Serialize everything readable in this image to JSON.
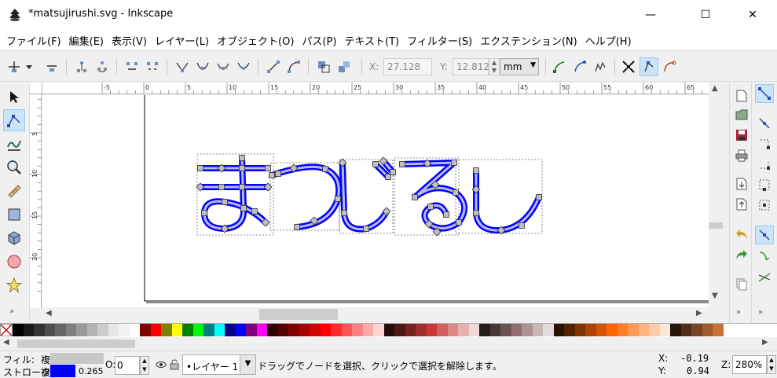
{
  "window": {
    "title": "*matsujirushi.svg - Inkscape",
    "app_icon": "inkscape-icon",
    "controls": {
      "minimize": "—",
      "maximize": "☐",
      "close": "✕"
    }
  },
  "menu": [
    "ファイル(F)",
    "編集(E)",
    "表示(V)",
    "レイヤー(L)",
    "オブジェクト(O)",
    "パス(P)",
    "テキスト(T)",
    "フィルター(S)",
    "エクステンション(N)",
    "ヘルプ(H)"
  ],
  "toolcontrols": {
    "x_label": "X:",
    "x_value": "27.128",
    "y_label": "Y:",
    "y_value": "12.812",
    "unit": "mm"
  },
  "rulers": {
    "h_ticks": [
      "-5",
      "0",
      "5",
      "10",
      "15",
      "20",
      "25",
      "30",
      "35",
      "40",
      "45",
      "50",
      "55",
      "60",
      "65"
    ],
    "v_ticks": [
      "0",
      "5",
      "10",
      "15",
      "20"
    ]
  },
  "colors": {
    "stroke": "#0000ff",
    "accent": "#99c9ef",
    "node_fill": "#c0c0c0"
  },
  "palette": [
    "#000000",
    "#1a1a1a",
    "#333333",
    "#4d4d4d",
    "#666666",
    "#808080",
    "#999999",
    "#b3b3b3",
    "#cccccc",
    "#e6e6e6",
    "#f2f2f2",
    "#ffffff",
    "#800000",
    "#ff0000",
    "#808000",
    "#ffff00",
    "#008000",
    "#00ff00",
    "#008080",
    "#00ffff",
    "#000080",
    "#0000ff",
    "#800080",
    "#ff00ff",
    "#2b0000",
    "#550000",
    "#800000",
    "#aa0000",
    "#d40000",
    "#ff0000",
    "#ff2a2a",
    "#ff5555",
    "#ff8080",
    "#ffaaaa",
    "#ffd5d5",
    "#280b0b",
    "#501616",
    "#782121",
    "#a02c2c",
    "#c83737",
    "#d35f5f",
    "#de8787",
    "#e9afaf",
    "#f4d7d7",
    "#241c1c",
    "#483737",
    "#6c5353",
    "#916f6f",
    "#ac9393",
    "#c8b7b7",
    "#e3dbdb",
    "#2b1100",
    "#552200",
    "#803300",
    "#aa4400",
    "#d45500",
    "#ff6600",
    "#ff7f2a",
    "#ff9955",
    "#ffb380",
    "#ffccaa",
    "#ffe6d5",
    "#28170b",
    "#502d16",
    "#784421",
    "#a05a2c",
    "#c87137"
  ],
  "status": {
    "fill_label": "フィル:",
    "fill_value": "複",
    "stroke_label": "ストローク:",
    "stroke_value": "複",
    "stroke_width": "0.265",
    "opacity_label": "O:",
    "opacity_value": "0",
    "layer": "•レイヤー 1",
    "message": "ドラッグでノードを選択、クリックで選択を解除します。",
    "x_label": "X:",
    "x_value": "-0.19",
    "y_label": "Y:",
    "y_value": "0.94",
    "zoom_label": "Z:",
    "zoom_value": "280%"
  }
}
